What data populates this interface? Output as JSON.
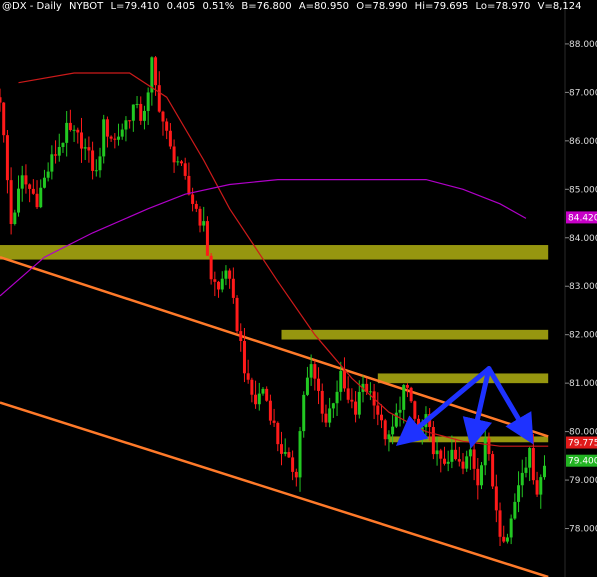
{
  "header": {
    "symbol": "@DX - Daily",
    "exchange": "NYBOT",
    "last": "L=79.410",
    "change": "0.405",
    "change_pct": "0.51%",
    "bid": "B=76.800",
    "ask": "A=80.950",
    "open": "O=78.990",
    "high": "Hi=79.695",
    "low": "Lo=78.970",
    "volume": "V=8,124"
  },
  "price_tags": {
    "sma200": "84.420",
    "sma50": "79.775",
    "last": "79.400"
  },
  "colors": {
    "background": "#000000",
    "up_candle": "#22c822",
    "down_candle": "#ff1a1a",
    "sma50": "#cc1a1a",
    "sma200": "#b000c8",
    "channel_line": "#ff7a2a",
    "zone": "#c8c814",
    "arrow": "#1e32ff",
    "last_tag_bg": "#22b422",
    "sma200_tag_bg": "#c800c8",
    "sma50_tag_bg": "#e01a1a"
  },
  "chart_data": {
    "type": "candlestick",
    "title": "@DX - Daily",
    "ylim": [
      77.0,
      88.7
    ],
    "y_ticks": [
      "78.000",
      "79.000",
      "80.000",
      "81.000",
      "82.000",
      "83.000",
      "84.000",
      "85.000",
      "86.000",
      "87.000",
      "88.000"
    ],
    "y_tick_values": [
      78,
      79,
      80,
      81,
      82,
      83,
      84,
      85,
      86,
      87,
      88
    ],
    "grid": false,
    "close_path": [
      [
        0,
        86.9
      ],
      [
        3,
        84.3
      ],
      [
        6,
        85.2
      ],
      [
        10,
        84.8
      ],
      [
        14,
        85.6
      ],
      [
        18,
        86.2
      ],
      [
        22,
        86.0
      ],
      [
        26,
        85.3
      ],
      [
        28,
        86.3
      ],
      [
        31,
        86.0
      ],
      [
        34,
        86.4
      ],
      [
        36,
        86.7
      ],
      [
        38,
        86.5
      ],
      [
        40,
        86.9
      ],
      [
        41,
        87.6
      ],
      [
        42,
        87.1
      ],
      [
        44,
        86.4
      ],
      [
        46,
        85.8
      ],
      [
        48,
        85.6
      ],
      [
        51,
        84.9
      ],
      [
        53,
        84.6
      ],
      [
        55,
        84.2
      ],
      [
        57,
        83.2
      ],
      [
        59,
        82.9
      ],
      [
        61,
        83.4
      ],
      [
        63,
        82.6
      ],
      [
        65,
        81.8
      ],
      [
        67,
        80.9
      ],
      [
        69,
        80.6
      ],
      [
        71,
        80.9
      ],
      [
        73,
        80.4
      ],
      [
        75,
        79.8
      ],
      [
        78,
        79.3
      ],
      [
        80,
        79.2
      ],
      [
        82,
        80.8
      ],
      [
        84,
        81.3
      ],
      [
        86,
        80.8
      ],
      [
        88,
        80.2
      ],
      [
        90,
        80.7
      ],
      [
        92,
        81.1
      ],
      [
        94,
        80.6
      ],
      [
        96,
        80.4
      ],
      [
        98,
        81.0
      ],
      [
        101,
        80.7
      ],
      [
        103,
        80.1
      ],
      [
        105,
        79.8
      ],
      [
        107,
        80.3
      ],
      [
        109,
        80.9
      ],
      [
        111,
        80.6
      ],
      [
        113,
        79.9
      ],
      [
        115,
        80.2
      ],
      [
        117,
        79.7
      ],
      [
        119,
        79.3
      ],
      [
        121,
        79.5
      ],
      [
        123,
        79.4
      ],
      [
        125,
        79.2
      ],
      [
        127,
        79.6
      ],
      [
        129,
        79.0
      ],
      [
        131,
        79.9
      ],
      [
        133,
        78.9
      ],
      [
        135,
        78.0
      ],
      [
        137,
        77.8
      ],
      [
        139,
        78.6
      ],
      [
        141,
        79.3
      ],
      [
        143,
        79.5
      ],
      [
        145,
        78.8
      ],
      [
        147,
        79.3
      ]
    ],
    "sma50_path": [
      [
        5,
        87.2
      ],
      [
        20,
        87.4
      ],
      [
        35,
        87.4
      ],
      [
        45,
        86.9
      ],
      [
        55,
        85.6
      ],
      [
        62,
        84.6
      ],
      [
        75,
        83.1
      ],
      [
        85,
        82.0
      ],
      [
        95,
        81.1
      ],
      [
        105,
        80.4
      ],
      [
        115,
        80.0
      ],
      [
        125,
        79.8
      ],
      [
        135,
        79.7
      ],
      [
        148,
        79.7
      ]
    ],
    "sma200_path": [
      [
        0,
        82.8
      ],
      [
        12,
        83.6
      ],
      [
        25,
        84.1
      ],
      [
        40,
        84.6
      ],
      [
        50,
        84.9
      ],
      [
        62,
        85.1
      ],
      [
        75,
        85.2
      ],
      [
        90,
        85.2
      ],
      [
        105,
        85.2
      ],
      [
        115,
        85.2
      ],
      [
        125,
        85.0
      ],
      [
        135,
        84.7
      ],
      [
        142,
        84.4
      ]
    ],
    "channel_lines": [
      {
        "from": [
          0,
          83.6
        ],
        "to": [
          148,
          79.9
        ]
      },
      {
        "from": [
          0,
          80.6
        ],
        "to": [
          148,
          77.0
        ]
      }
    ],
    "zones": [
      {
        "x_from": 0,
        "x_to": 148,
        "y_low": 83.55,
        "y_high": 83.85
      },
      {
        "x_from": 76,
        "x_to": 148,
        "y_low": 81.9,
        "y_high": 82.1
      },
      {
        "x_from": 102,
        "x_to": 148,
        "y_low": 81.0,
        "y_high": 81.2
      },
      {
        "x_from": 105,
        "x_to": 148,
        "y_low": 79.78,
        "y_high": 79.9
      }
    ],
    "arrows": [
      {
        "from": [
          132,
          81.3
        ],
        "to": [
          110,
          79.9
        ]
      },
      {
        "from": [
          132,
          81.3
        ],
        "to": [
          128,
          79.95
        ]
      },
      {
        "from": [
          132,
          81.3
        ],
        "to": [
          142,
          80.0
        ]
      }
    ],
    "x_range": [
      0,
      152
    ]
  }
}
